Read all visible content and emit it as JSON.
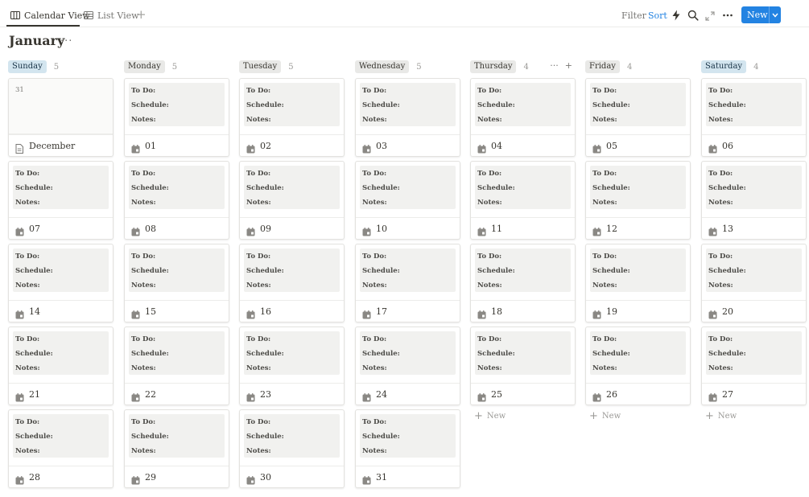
{
  "tabs": [
    {
      "label": "Calendar View",
      "icon": "calendar-columns-icon",
      "active": true
    },
    {
      "label": "List View",
      "icon": "table-icon",
      "active": false
    }
  ],
  "add_view": "+",
  "toolbar": {
    "filter": "Filter",
    "sort": "Sort",
    "new_label": "New",
    "icons": [
      "lightning-icon",
      "search-icon",
      "expand-icon",
      "more-icon"
    ]
  },
  "title": "January",
  "title_more": "···",
  "preview_labels": {
    "todo": "To Do:",
    "schedule": "Schedule:",
    "notes": "Notes:"
  },
  "new_row_label": "New",
  "colors": {
    "accent": "#2383e2",
    "weekend_pill": "#d3e5ef",
    "weekday_pill": "#e9e9e7"
  },
  "columns": [
    {
      "day": "Sunday",
      "count": "5",
      "weekend": true,
      "cards": [
        {
          "name": "December",
          "daynum": "31",
          "blank": true,
          "icon": "page-icon"
        },
        {
          "name": "07"
        },
        {
          "name": "14"
        },
        {
          "name": "21"
        },
        {
          "name": "28"
        }
      ]
    },
    {
      "day": "Monday",
      "count": "5",
      "weekend": false,
      "cards": [
        {
          "name": "01"
        },
        {
          "name": "08"
        },
        {
          "name": "15"
        },
        {
          "name": "22"
        },
        {
          "name": "29"
        }
      ]
    },
    {
      "day": "Tuesday",
      "count": "5",
      "weekend": false,
      "cards": [
        {
          "name": "02"
        },
        {
          "name": "09"
        },
        {
          "name": "16"
        },
        {
          "name": "23"
        },
        {
          "name": "30"
        }
      ]
    },
    {
      "day": "Wednesday",
      "count": "5",
      "weekend": false,
      "cards": [
        {
          "name": "03"
        },
        {
          "name": "10"
        },
        {
          "name": "17"
        },
        {
          "name": "24"
        },
        {
          "name": "31"
        }
      ]
    },
    {
      "day": "Thursday",
      "count": "4",
      "weekend": false,
      "actions": [
        "···",
        "+"
      ],
      "cards": [
        {
          "name": "04"
        },
        {
          "name": "11"
        },
        {
          "name": "18"
        },
        {
          "name": "25"
        }
      ],
      "new_row": true
    },
    {
      "day": "Friday",
      "count": "4",
      "weekend": false,
      "cards": [
        {
          "name": "05"
        },
        {
          "name": "12"
        },
        {
          "name": "19"
        },
        {
          "name": "26"
        }
      ],
      "new_row": true
    },
    {
      "day": "Saturday",
      "count": "4",
      "weekend": true,
      "cards": [
        {
          "name": "06"
        },
        {
          "name": "13"
        },
        {
          "name": "20"
        },
        {
          "name": "27"
        }
      ],
      "new_row": true
    }
  ]
}
